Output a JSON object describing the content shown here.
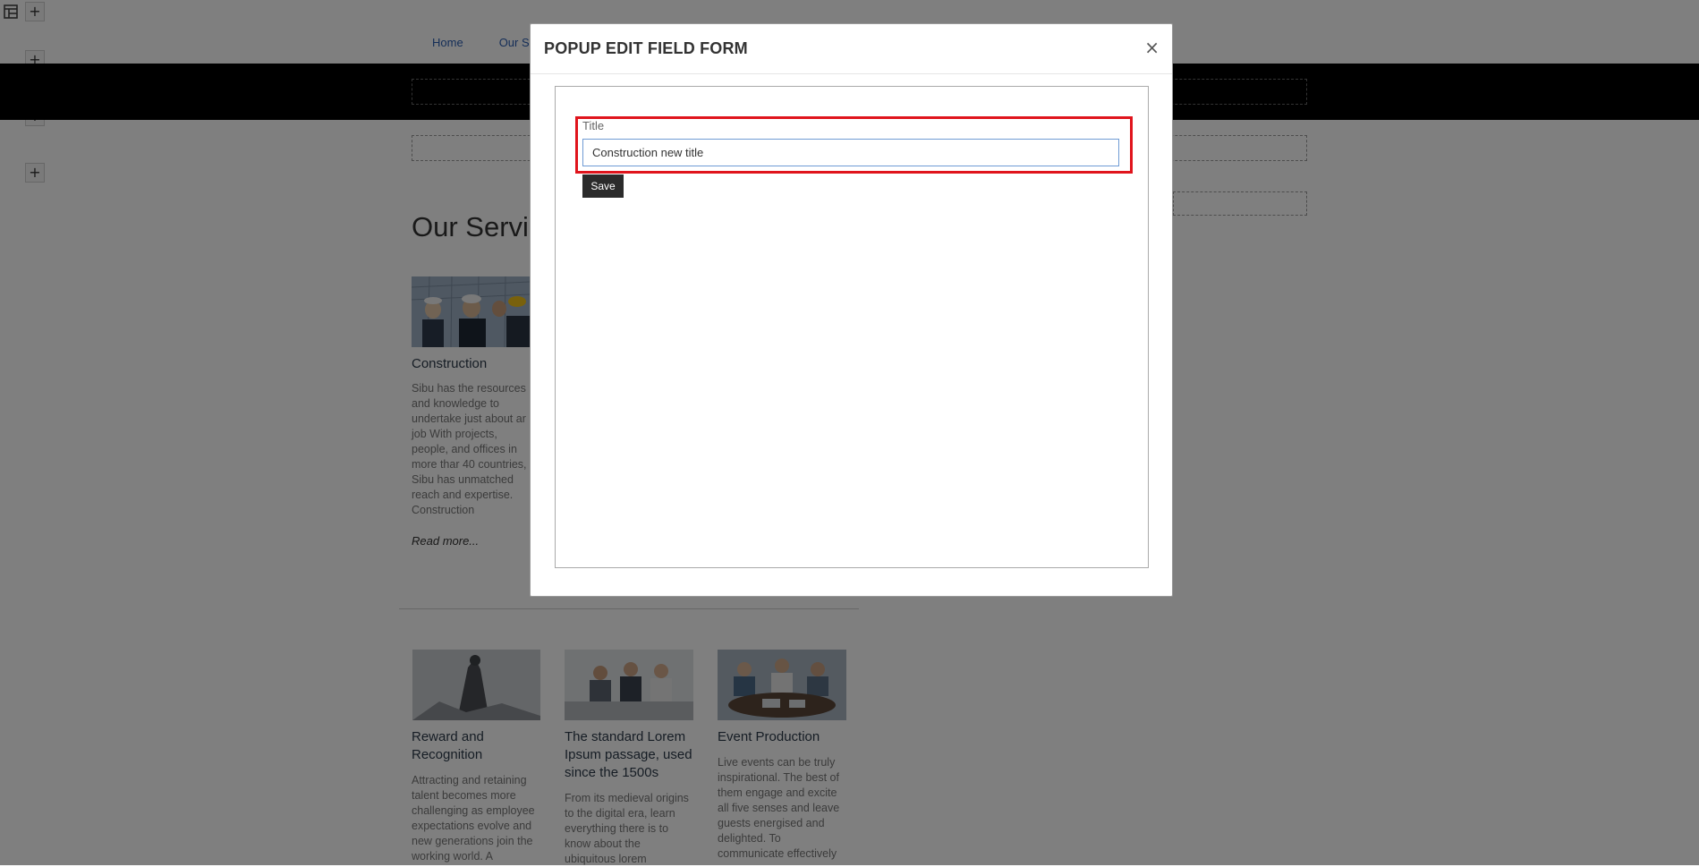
{
  "nav": {
    "home": "Home",
    "services": "Our Ser"
  },
  "page": {
    "section_title": "Our Servic",
    "read_more": "Read more...",
    "construction": {
      "title": "Construction",
      "text": "Sibu has the resources and knowledge to undertake just about ar job With projects, people, and offices in more thar 40 countries, Sibu has unmatched reach and expertise. Construction"
    },
    "cards": [
      {
        "title": "Reward and Recognition",
        "text": "Attracting and retaining talent becomes more challenging as employee expectations evolve and new generations join the working world. A"
      },
      {
        "title": "The standard Lorem Ipsum passage, used since the 1500s",
        "text": "From its medieval origins to the digital era, learn everything there is to know about the ubiquitous lorem"
      },
      {
        "title": "Event Production",
        "text": "Live events can be truly inspirational. The best of them engage and excite all five senses and leave guests energised and delighted. To communicate effectively"
      }
    ]
  },
  "toolbar": {
    "layout_icon": "layout-icon",
    "add_icon": "plus-icon",
    "add_label": "+"
  },
  "modal": {
    "title": "POPUP EDIT FIELD FORM",
    "close_label": "×",
    "field_label": "Title",
    "field_value": "Construction new title",
    "save_label": "Save",
    "highlight_color": "#e0141c"
  }
}
